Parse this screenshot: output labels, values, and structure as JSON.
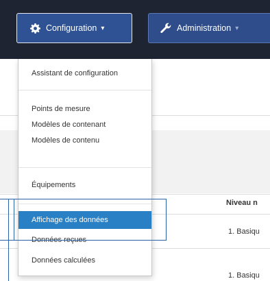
{
  "navbar": {
    "configuration_label": "Configuration",
    "configuration_icon": "gear-icon",
    "administration_label": "Administration",
    "administration_icon": "wrench-icon",
    "caret": "▾"
  },
  "configuration_menu": {
    "items": [
      {
        "label": "Assistant de configuration",
        "selected": false
      },
      {
        "label": "Points de mesure",
        "selected": false
      },
      {
        "label": "Modèles de contenant",
        "selected": false
      },
      {
        "label": "Modèles de contenu",
        "selected": false
      },
      {
        "label": "Équipements",
        "selected": false
      },
      {
        "label": "Affichage des données",
        "selected": true
      },
      {
        "label": "Données reçues",
        "selected": false
      },
      {
        "label": "Données calculées",
        "selected": false
      }
    ]
  },
  "table": {
    "column_header": "Niveau n",
    "rows": [
      "1. Basiqu",
      "1. Basiqu"
    ]
  },
  "colors": {
    "navbar_bg": "#1f2432",
    "nav_button": "#2e4d8a",
    "selected_item": "#2a80c4",
    "highlight_annotation": "#2a62a6"
  }
}
